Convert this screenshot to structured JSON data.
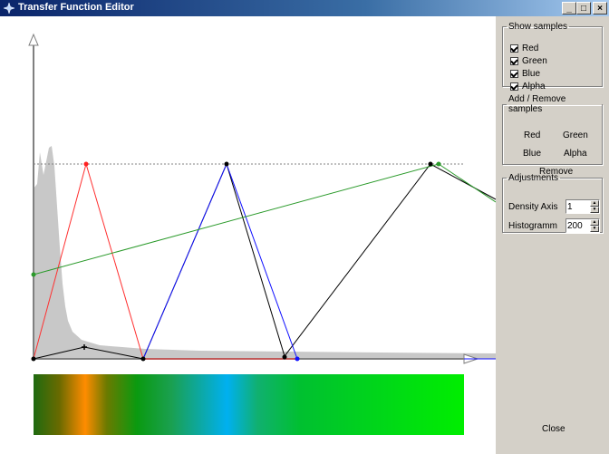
{
  "window": {
    "title": "Transfer Function Editor",
    "controls": {
      "minimize": "_",
      "maximize": "□",
      "close": "×"
    }
  },
  "show_samples": {
    "legend": "Show samples",
    "items": [
      {
        "label": "Red",
        "checked": true
      },
      {
        "label": "Green",
        "checked": true
      },
      {
        "label": "Blue",
        "checked": true
      },
      {
        "label": "Alpha",
        "checked": true
      }
    ]
  },
  "add_remove": {
    "legend": "Add / Remove samples",
    "red": "Red",
    "green": "Green",
    "blue": "Blue",
    "alpha": "Alpha",
    "remove": "Remove"
  },
  "adjustments": {
    "legend": "Adjustments",
    "density_axis_label": "Density Axis",
    "density_axis_value": "1",
    "histogram_label": "Histogramm",
    "histogram_value": "200"
  },
  "close_label": "Close",
  "colors": {
    "red": "#ff3030",
    "green": "#2a9a2a",
    "blue": "#1010ff",
    "alpha": "#000000",
    "histogram": "#c8c8c8",
    "axis": "#808080"
  }
}
